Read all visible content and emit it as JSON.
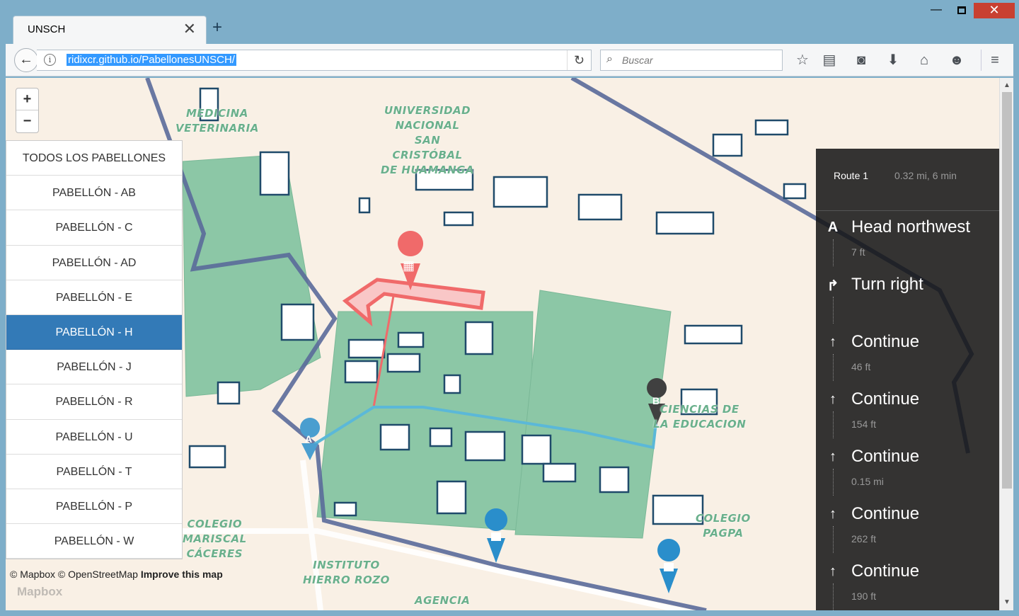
{
  "browser": {
    "tab_title": "UNSCH",
    "url": "ridixcr.github.io/PabellonesUNSCH/",
    "search_placeholder": "Buscar",
    "icons": [
      "back-arrow-icon",
      "info-icon",
      "reload-icon",
      "search-icon",
      "bookmark-star-icon",
      "reading-list-icon",
      "pocket-icon",
      "download-icon",
      "home-icon",
      "feedback-icon",
      "menu-icon"
    ]
  },
  "map": {
    "zoom_in": "+",
    "zoom_out": "−",
    "labels": {
      "veterinaria": "MEDICINA\nVETERINARIA",
      "universidad": "UNIVERSIDAD\nNACIONAL\nSAN\nCRISTÓBAL\nDE HUAMANGA",
      "ciencias": "CIENCIAS DE\nLA EDUCACION",
      "colegio_mariscal": "COLEGIO\nMARISCAL\nCÁCERES",
      "colegio_pagpa": "COLEGIO\nPAGPA",
      "instituto": "INSTITUTO\nHIERRO ROZO",
      "agencia": "AGENCIA"
    },
    "marker_a": "A",
    "marker_b": "B",
    "attribution": {
      "mapbox": "© Mapbox",
      "osm": "© OpenStreetMap",
      "improve": "Improve this map"
    },
    "watermark": "Mapbox"
  },
  "pabellones": {
    "items": [
      "TODOS LOS PABELLONES",
      "PABELLÓN - AB",
      "PABELLÓN - C",
      "PABELLÓN - AD",
      "PABELLÓN - E",
      "PABELLÓN - H",
      "PABELLÓN - J",
      "PABELLÓN - R",
      "PABELLÓN - U",
      "PABELLÓN - T",
      "PABELLÓN - P",
      "PABELLÓN - W"
    ],
    "active": "PABELLÓN - H"
  },
  "directions": {
    "route_name": "Route 1",
    "summary": "0.32 mi, 6 min",
    "steps": [
      {
        "icon": "A",
        "text": "Head northwest",
        "distance": "7 ft"
      },
      {
        "icon": "↱",
        "text": "Turn right",
        "distance": ""
      },
      {
        "icon": "↑",
        "text": "Continue",
        "distance": "46 ft"
      },
      {
        "icon": "↑",
        "text": "Continue",
        "distance": "154 ft"
      },
      {
        "icon": "↑",
        "text": "Continue",
        "distance": "0.15 mi"
      },
      {
        "icon": "↑",
        "text": "Continue",
        "distance": "262 ft"
      },
      {
        "icon": "↑",
        "text": "Continue",
        "distance": "190 ft"
      }
    ]
  },
  "colors": {
    "map_background": "#f9f0e5",
    "green_area": "#8cc7a6",
    "boundary": "#5a6a9a",
    "route_blue": "#5bb8d8",
    "route_red": "#f06a6a",
    "active_item": "#337ab7"
  }
}
